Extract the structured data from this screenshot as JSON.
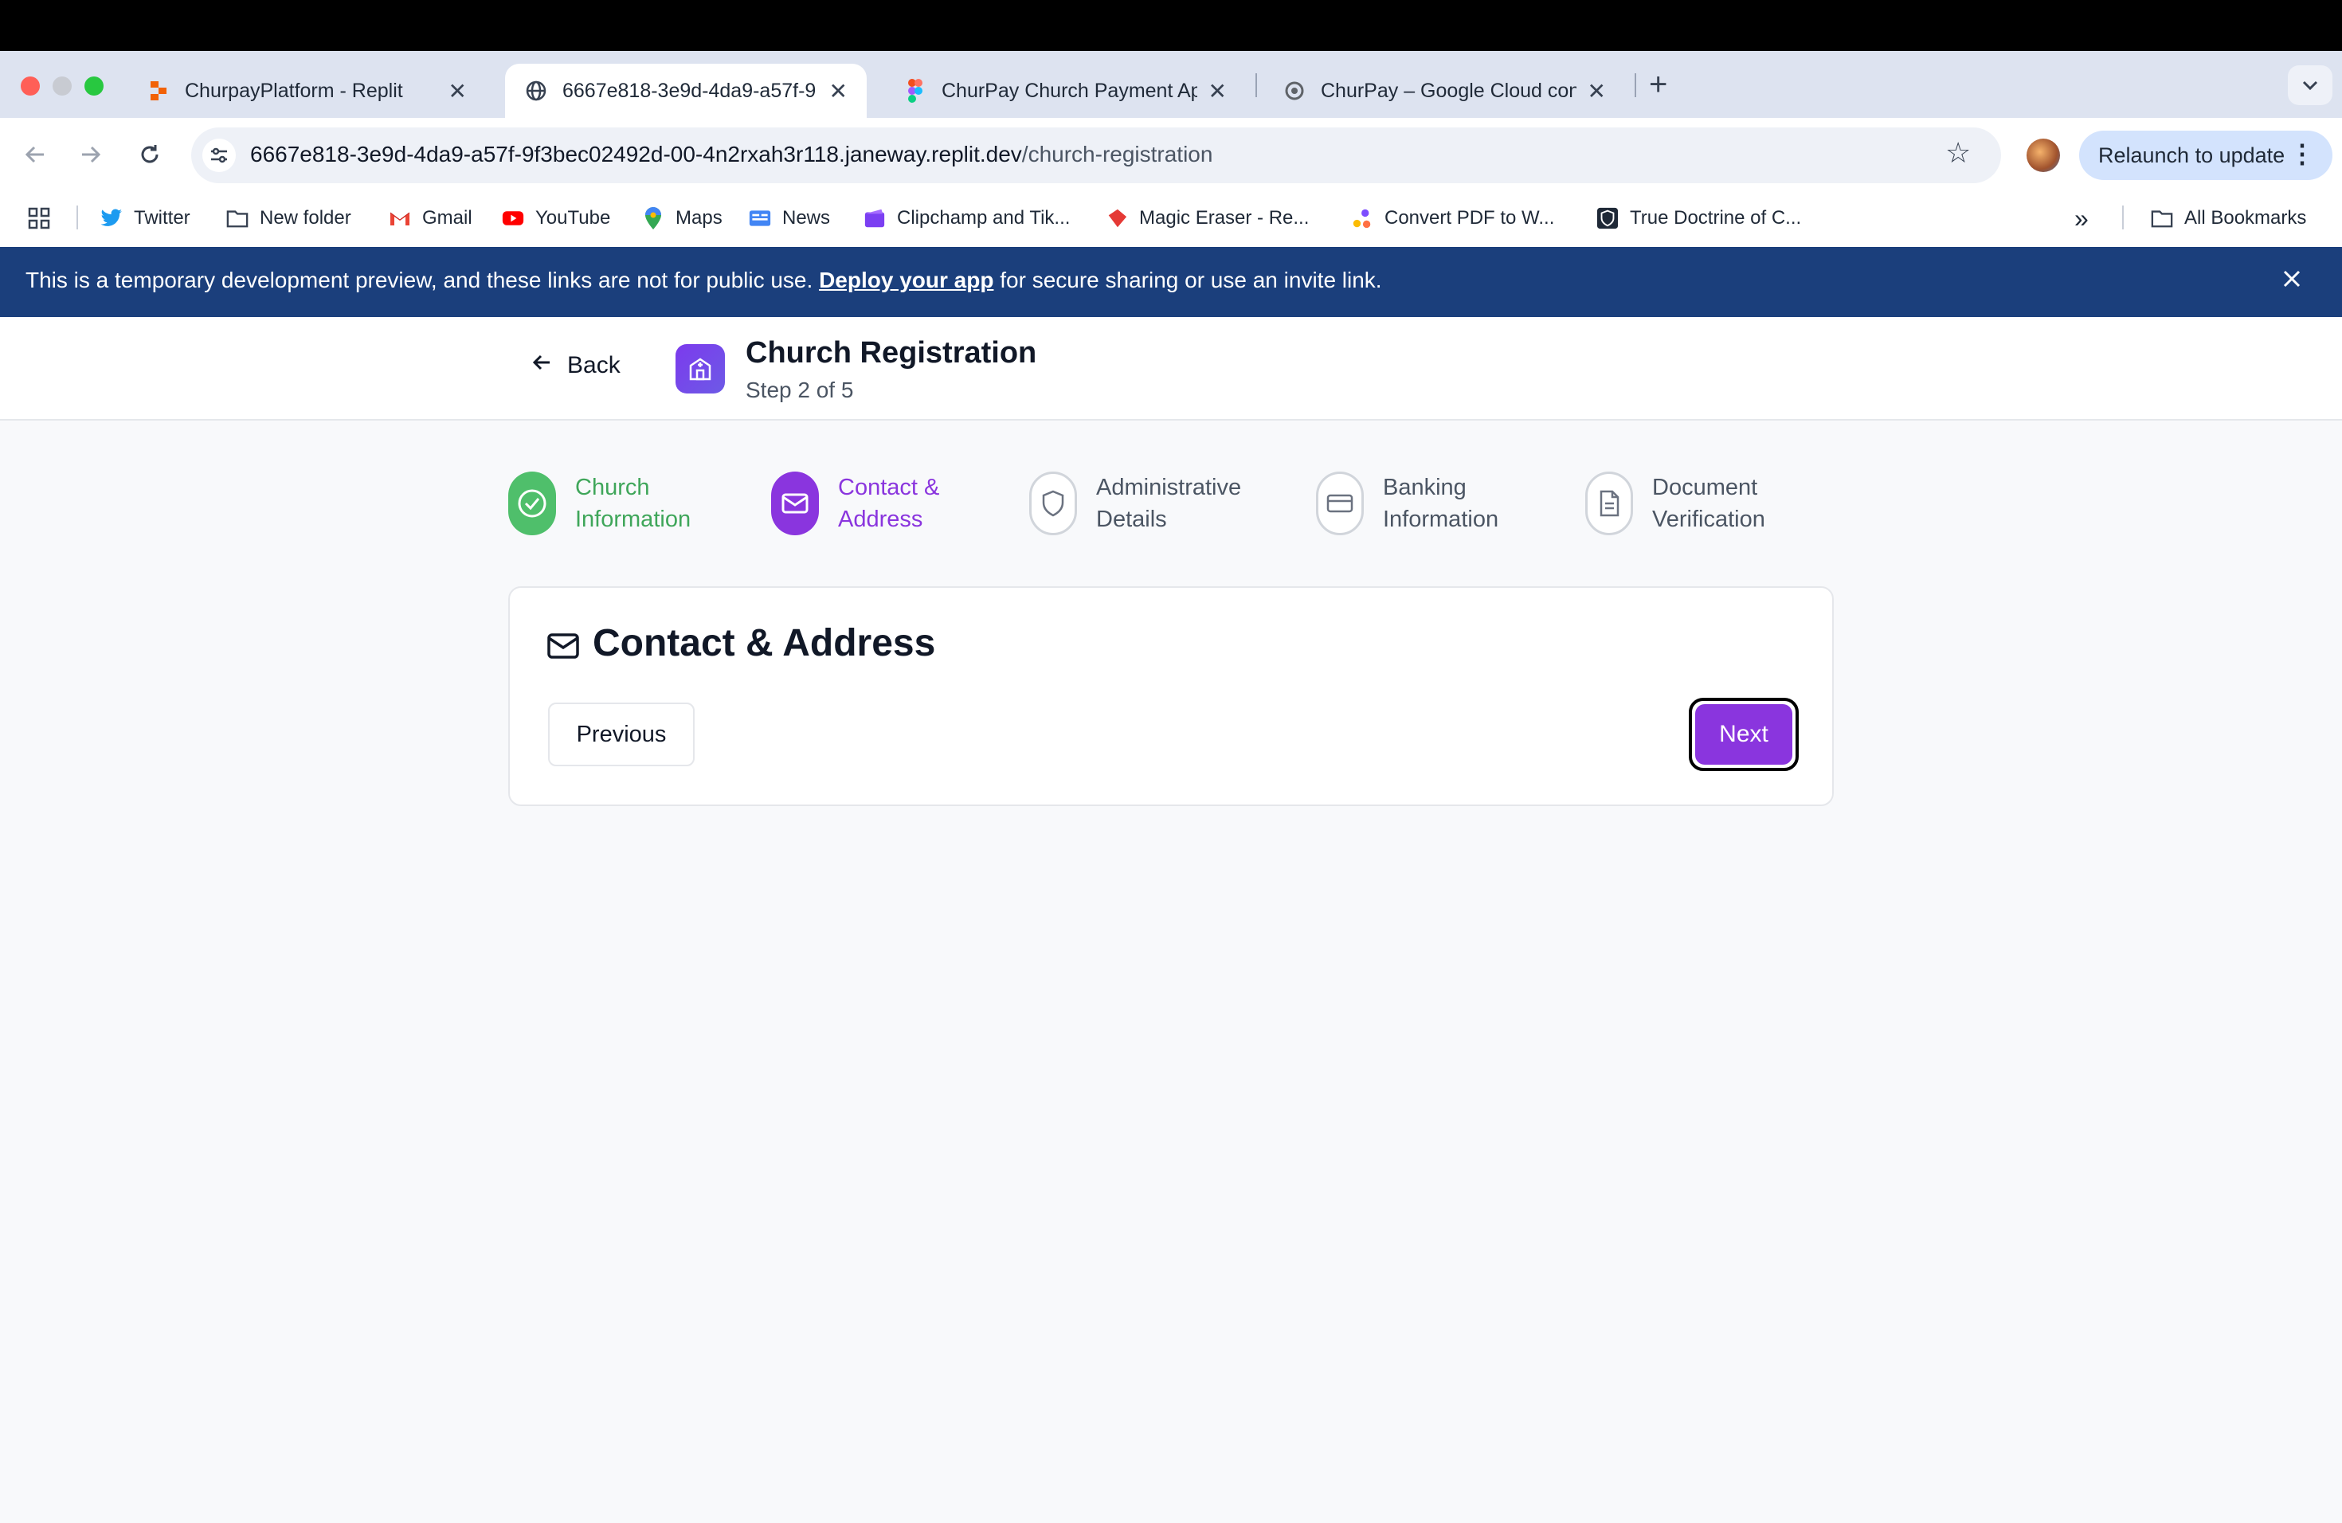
{
  "browser": {
    "tabs": [
      {
        "title": "ChurpayPlatform - Replit",
        "active": false,
        "icon": "replit-icon"
      },
      {
        "title": "6667e818-3e9d-4da9-a57f-9",
        "active": true,
        "icon": "globe-icon"
      },
      {
        "title": "ChurPay Church Payment App",
        "active": false,
        "icon": "figma-icon"
      },
      {
        "title": "ChurPay – Google Cloud cons",
        "active": false,
        "icon": "google-cloud-icon"
      }
    ],
    "close_glyph": "✕",
    "new_tab_glyph": "+",
    "url_host": "6667e818-3e9d-4da9-a57f-9f3bec02492d-00-4n2rxah3r118.janeway.replit.dev",
    "url_path": "/church-registration",
    "relaunch_label": "Relaunch to update",
    "bookmarks": [
      {
        "label": "Twitter",
        "icon": "twitter-icon"
      },
      {
        "label": "New folder",
        "icon": "folder-icon"
      },
      {
        "label": "Gmail",
        "icon": "gmail-icon"
      },
      {
        "label": "YouTube",
        "icon": "youtube-icon"
      },
      {
        "label": "Maps",
        "icon": "maps-icon"
      },
      {
        "label": "News",
        "icon": "news-icon"
      },
      {
        "label": "Clipchamp and Tik...",
        "icon": "clipchamp-icon"
      },
      {
        "label": "Magic Eraser - Re...",
        "icon": "magic-eraser-icon"
      },
      {
        "label": "Convert PDF to W...",
        "icon": "convert-pdf-icon"
      },
      {
        "label": "True Doctrine of C...",
        "icon": "shield-bookmark-icon"
      }
    ],
    "all_bookmarks_label": "All Bookmarks"
  },
  "banner": {
    "text_before": "This is a temporary development preview, and these links are not for public use. ",
    "link": "Deploy your app",
    "text_after": " for secure sharing or use an invite link."
  },
  "header": {
    "back_label": "Back",
    "title": "Church Registration",
    "step_text": "Step 2 of 5"
  },
  "steps": [
    {
      "line1": "Church",
      "line2": "Information",
      "state": "done",
      "icon": "check-circle-icon"
    },
    {
      "line1": "Contact &",
      "line2": "Address",
      "state": "current",
      "icon": "mail-icon"
    },
    {
      "line1": "Administrative",
      "line2": "Details",
      "state": "pending",
      "icon": "shield-icon"
    },
    {
      "line1": "Banking",
      "line2": "Information",
      "state": "pending",
      "icon": "credit-card-icon"
    },
    {
      "line1": "Document",
      "line2": "Verification",
      "state": "pending",
      "icon": "document-icon"
    }
  ],
  "card": {
    "title": "Contact & Address",
    "previous_label": "Previous",
    "next_label": "Next"
  },
  "colors": {
    "accent": "#8a35de",
    "success": "#4fbf6b",
    "banner": "#1b3f7c"
  }
}
